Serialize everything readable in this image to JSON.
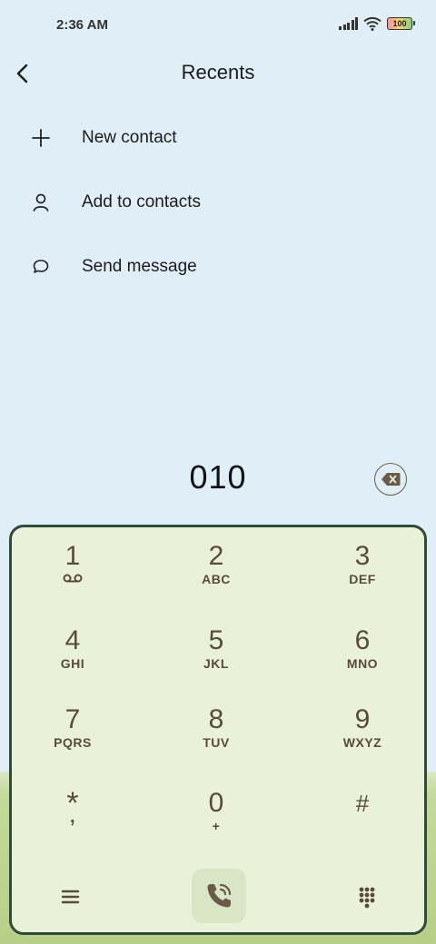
{
  "status_bar": {
    "time": "2:36 AM",
    "battery": "100"
  },
  "header": {
    "title": "Recents"
  },
  "menu": [
    {
      "label": "New contact",
      "icon": "plus-icon"
    },
    {
      "label": "Add to contacts",
      "icon": "person-icon"
    },
    {
      "label": "Send message",
      "icon": "chat-bubble-icon"
    }
  ],
  "dialer": {
    "number": "010",
    "keys": [
      {
        "digit": "1",
        "letters": ""
      },
      {
        "digit": "2",
        "letters": "ABC"
      },
      {
        "digit": "3",
        "letters": "DEF"
      },
      {
        "digit": "4",
        "letters": "GHI"
      },
      {
        "digit": "5",
        "letters": "JKL"
      },
      {
        "digit": "6",
        "letters": "MNO"
      },
      {
        "digit": "7",
        "letters": "PQRS"
      },
      {
        "digit": "8",
        "letters": "TUV"
      },
      {
        "digit": "9",
        "letters": "WXYZ"
      },
      {
        "digit": "*",
        "letters": ","
      },
      {
        "digit": "0",
        "letters": "+"
      },
      {
        "digit": "#",
        "letters": ""
      }
    ]
  },
  "colors": {
    "background": "#e0eff7",
    "pad": "#e9f2d9",
    "pad_border": "#2f4c3a",
    "key_text": "#5a4a3c"
  }
}
